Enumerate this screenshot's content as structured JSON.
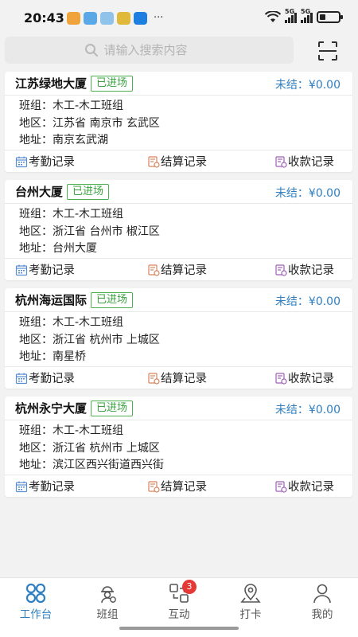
{
  "status_bar": {
    "time": "20:43",
    "more": "···",
    "network_1": "5G",
    "network_2": "5G",
    "battery_level": 0.3
  },
  "search": {
    "placeholder": "请输入搜索内容"
  },
  "colors": {
    "accent": "#2f7fc1",
    "badge_green": "#3aa13e",
    "tab_badge": "#e53935"
  },
  "projects": [
    {
      "name": "江苏绿地大厦",
      "status": "已进场",
      "amount": "未结：¥0.00",
      "team": "班组：木工-木工班组",
      "region": "地区：江苏省 南京市 玄武区",
      "address": "地址：南京玄武湖",
      "actions": [
        "考勤记录",
        "结算记录",
        "收款记录"
      ]
    },
    {
      "name": "台州大厦",
      "status": "已进场",
      "amount": "未结：¥0.00",
      "team": "班组：木工-木工班组",
      "region": "地区：浙江省 台州市 椒江区",
      "address": "地址：台州大厦",
      "actions": [
        "考勤记录",
        "结算记录",
        "收款记录"
      ]
    },
    {
      "name": "杭州海运国际",
      "status": "已进场",
      "amount": "未结：¥0.00",
      "team": "班组：木工-木工班组",
      "region": "地区：浙江省 杭州市 上城区",
      "address": "地址：南星桥",
      "actions": [
        "考勤记录",
        "结算记录",
        "收款记录"
      ]
    },
    {
      "name": "杭州永宁大厦",
      "status": "已进场",
      "amount": "未结：¥0.00",
      "team": "班组：木工-木工班组",
      "region": "地区：浙江省 杭州市 上城区",
      "address": "地址：滨江区西兴街道西兴街",
      "actions": [
        "考勤记录",
        "结算记录",
        "收款记录"
      ]
    }
  ],
  "tabbar": {
    "items": [
      {
        "label": "工作台",
        "icon": "grid-icon",
        "active": true
      },
      {
        "label": "班组",
        "icon": "team-icon"
      },
      {
        "label": "互动",
        "icon": "interact-icon",
        "badge": "3"
      },
      {
        "label": "打卡",
        "icon": "location-icon"
      },
      {
        "label": "我的",
        "icon": "user-icon"
      }
    ]
  }
}
